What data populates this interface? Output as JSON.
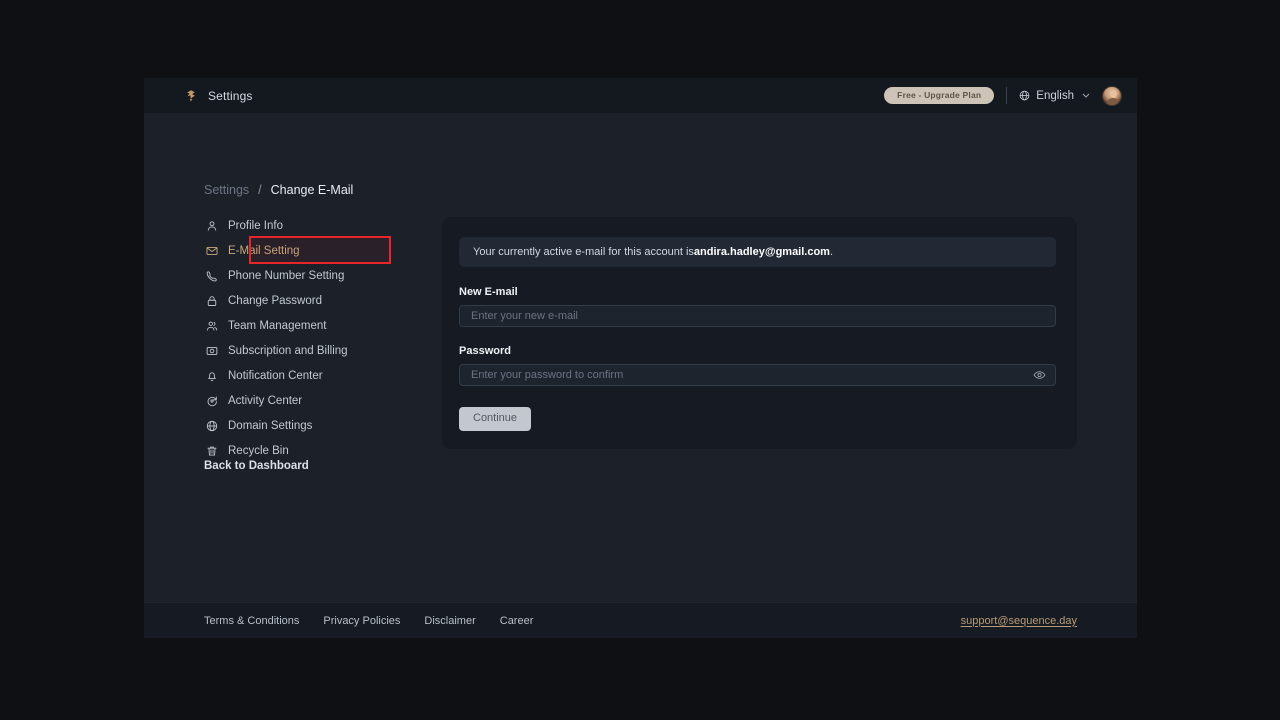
{
  "window": {
    "topbar": {
      "logo_icon": "origami-bird-logo",
      "title": "Settings",
      "plan_badge": "Free - Upgrade Plan",
      "language": {
        "globe_icon": "globe-icon",
        "label": "English",
        "chevron_icon": "chevron-down-icon"
      },
      "avatar_icon": "user-avatar"
    },
    "breadcrumb": {
      "parent": "Settings",
      "separator": "/",
      "current": "Change E-Mail"
    },
    "sidebar": {
      "items": [
        {
          "label": "Profile Info",
          "icon": "user-icon",
          "active": false
        },
        {
          "label": "E-Mail Setting",
          "icon": "envelope-icon",
          "active": true
        },
        {
          "label": "Phone Number Setting",
          "icon": "phone-icon",
          "active": false
        },
        {
          "label": "Change Password",
          "icon": "lock-icon",
          "active": false
        },
        {
          "label": "Team Management",
          "icon": "users-icon",
          "active": false
        },
        {
          "label": "Subscription and Billing",
          "icon": "card-icon",
          "active": false
        },
        {
          "label": "Notification Center",
          "icon": "bell-icon",
          "active": false
        },
        {
          "label": "Activity Center",
          "icon": "activity-icon",
          "active": false
        },
        {
          "label": "Domain Settings",
          "icon": "globe-icon",
          "active": false
        },
        {
          "label": "Recycle Bin",
          "icon": "trash-icon",
          "active": false
        }
      ],
      "back_to_dashboard": "Back to Dashboard"
    },
    "main": {
      "info_banner_prefix": "Your currently active e-mail for this account is ",
      "info_banner_email": "andira.hadley@gmail.com",
      "info_banner_suffix": ".",
      "new_email": {
        "label": "New E-mail",
        "placeholder": "Enter your new e-mail",
        "value": ""
      },
      "password": {
        "label": "Password",
        "placeholder": "Enter your password to confirm",
        "value": "",
        "toggle_icon": "eye-icon"
      },
      "continue_label": "Continue"
    },
    "footer": {
      "links": [
        "Terms & Conditions",
        "Privacy Policies",
        "Disclaimer",
        "Career"
      ],
      "support_email": "support@sequence.day"
    }
  },
  "colors": {
    "accent_gold": "#c9a97e",
    "badge_bg": "#cdc3b6",
    "highlight_red": "#e8262a",
    "card_bg": "#161b23",
    "body_bg": "#1b2029",
    "page_bg": "#0e1014"
  }
}
